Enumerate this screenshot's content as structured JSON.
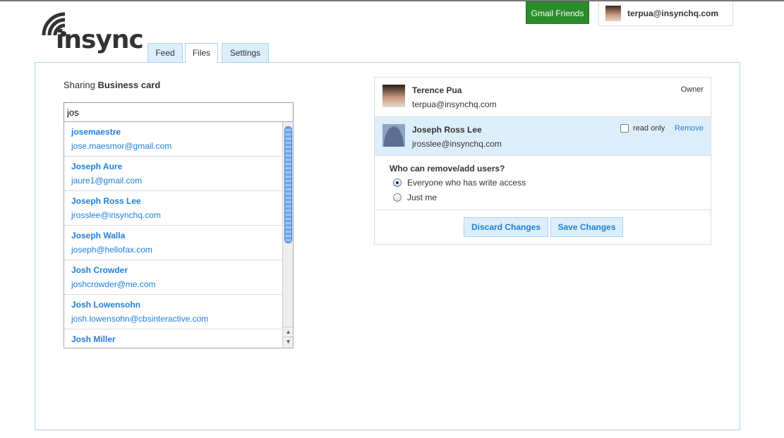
{
  "header": {
    "gmail_button": "Gmail Friends",
    "user_email": "terpua@insynchq.com",
    "logo_text": "insync"
  },
  "tabs": [
    {
      "label": "Feed"
    },
    {
      "label": "Files"
    },
    {
      "label": "Settings"
    }
  ],
  "sharing": {
    "prefix": "Sharing",
    "file_name": "Business card",
    "search_value": "jos"
  },
  "suggestions": [
    {
      "name": "josemaestre",
      "email": "jose.maesmor@gmail.com"
    },
    {
      "name": "Joseph Aure",
      "email": "jaure1@gmail.com"
    },
    {
      "name": "Joseph Ross Lee",
      "email": "jrosslee@insynchq.com"
    },
    {
      "name": "Joseph Walla",
      "email": "joseph@hellofax.com"
    },
    {
      "name": "Josh Crowder",
      "email": "joshcrowder@me.com"
    },
    {
      "name": "Josh Lowensohn",
      "email": "josh.lowensohn@cbsinteractive.com"
    },
    {
      "name": "Josh Miller",
      "email": ""
    }
  ],
  "members": [
    {
      "name": "Terence Pua",
      "email": "terpua@insynchq.com",
      "role": "Owner"
    },
    {
      "name": "Joseph Ross Lee",
      "email": "jrosslee@insynchq.com",
      "read_only_label": "read only",
      "remove_label": "Remove"
    }
  ],
  "permissions": {
    "question": "Who can remove/add users?",
    "options": [
      "Everyone who has write access",
      "Just me"
    ],
    "selected": 0
  },
  "buttons": {
    "discard": "Discard Changes",
    "save": "Save Changes"
  },
  "colors": {
    "accent": "#1e7fd8",
    "gmail_green": "#2a8d2a",
    "highlight": "#ddeefb"
  }
}
